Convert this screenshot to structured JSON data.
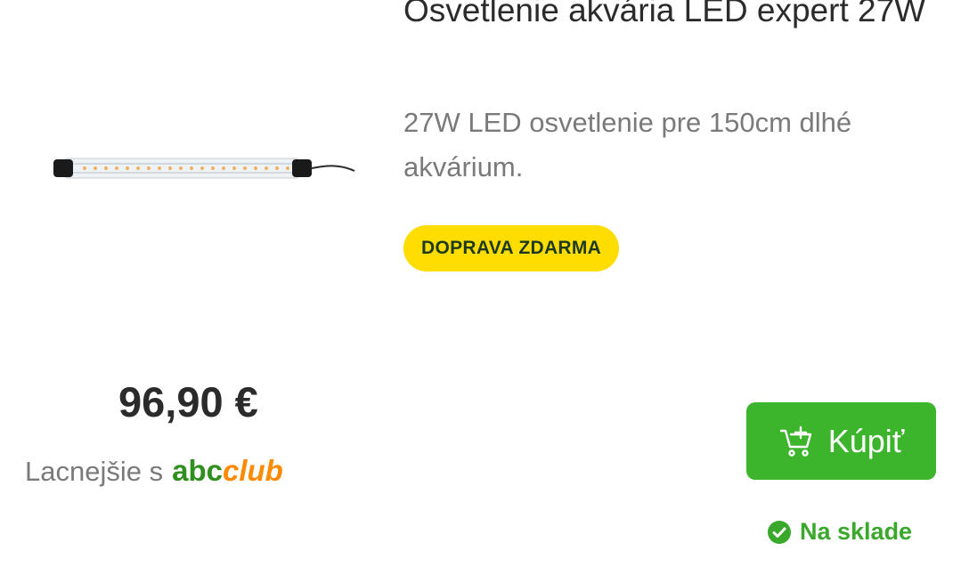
{
  "product": {
    "title": "Osvetlenie akvária LED expert 27W",
    "description": "27W LED osvetlenie pre 150cm dlhé akvárium.",
    "badge": "DOPRAVA ZDARMA",
    "price": "96,90 €",
    "club_prefix": "Lacnejšie s",
    "club_logo_abc": "abc",
    "club_logo_club": "club",
    "buy_label": "Kúpiť",
    "stock_label": "Na sklade"
  },
  "icons": {
    "cart": "cart-add-icon",
    "stock": "check-circle-icon"
  },
  "colors": {
    "badge_bg": "#ffdd00",
    "buy_bg": "#3cb52d",
    "stock": "#3aa82b",
    "club_green": "#2f8f1f",
    "club_orange": "#ff8a00"
  }
}
